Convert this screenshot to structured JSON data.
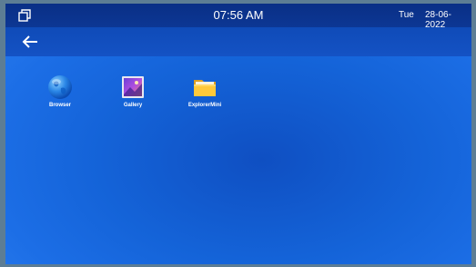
{
  "statusbar": {
    "recent_icon": "recent-apps-icon",
    "time": "07:56 AM",
    "day": "Tue",
    "date": "28-06-2022"
  },
  "navbar": {
    "back_icon": "back-arrow-icon"
  },
  "apps": [
    {
      "label": "Browser",
      "icon": "globe-icon"
    },
    {
      "label": "Gallery",
      "icon": "gallery-icon"
    },
    {
      "label": "ExplorerMini",
      "icon": "folder-icon"
    }
  ],
  "colors": {
    "status_bar": "#0a2f86",
    "nav_bar": "#1452c4",
    "desktop": "#1463d8"
  }
}
